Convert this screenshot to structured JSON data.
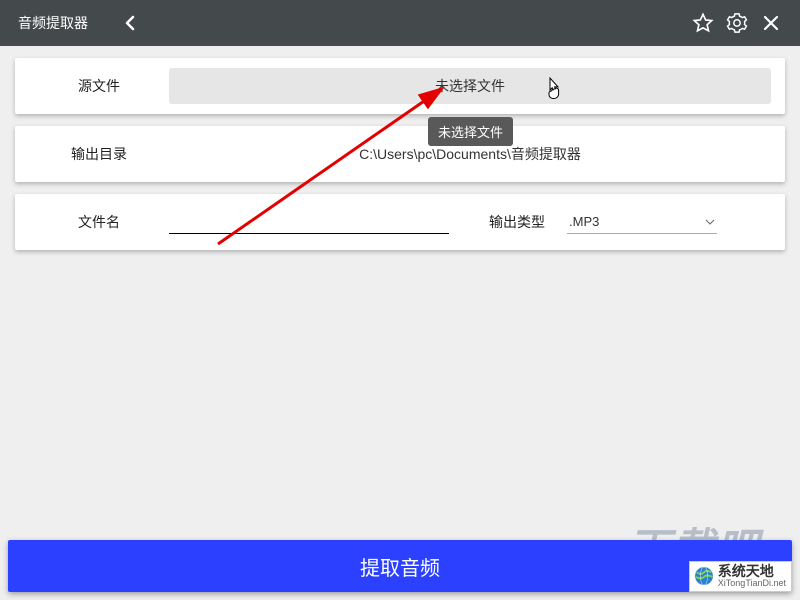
{
  "titlebar": {
    "title": "音频提取器"
  },
  "source": {
    "label": "源文件",
    "button_text": "未选择文件",
    "tooltip": "未选择文件"
  },
  "output_dir": {
    "label": "输出目录",
    "path": "C:\\Users\\pc\\Documents\\音频提取器"
  },
  "filename": {
    "label": "文件名",
    "value": ""
  },
  "output_type": {
    "label": "输出类型",
    "selected": ".MP3"
  },
  "primary_action": {
    "label": "提取音频"
  },
  "watermark": {
    "zh": "系统天地",
    "en": "XiTongTianDi.net",
    "bg": "下载吧"
  }
}
